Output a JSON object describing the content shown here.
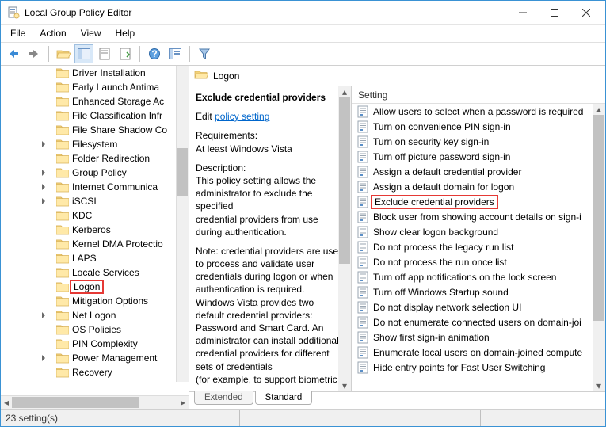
{
  "window": {
    "title": "Local Group Policy Editor"
  },
  "menu": {
    "file": "File",
    "action": "Action",
    "view": "View",
    "help": "Help"
  },
  "header": {
    "section_label": "Logon"
  },
  "desc": {
    "title": "Exclude credential providers",
    "edit_prefix": "Edit ",
    "edit_link": "policy setting",
    "req_label": "Requirements:",
    "req_text": "At least Windows Vista",
    "desc_label": "Description:",
    "p1": "This policy setting allows the administrator to exclude the specified",
    "p2": "credential providers from use during authentication.",
    "p3": "Note: credential providers are used to process and validate user credentials during logon or when authentication is required. Windows Vista provides two default credential providers: Password and Smart Card. An administrator can install additional credential providers for different sets of credentials",
    "p4": "(for example, to support biometric"
  },
  "list": {
    "column": "Setting"
  },
  "tree_items": [
    {
      "label": "Driver Installation",
      "exp": false
    },
    {
      "label": "Early Launch Antima",
      "exp": false
    },
    {
      "label": "Enhanced Storage Ac",
      "exp": false
    },
    {
      "label": "File Classification Infr",
      "exp": false
    },
    {
      "label": "File Share Shadow Co",
      "exp": false
    },
    {
      "label": "Filesystem",
      "exp": true
    },
    {
      "label": "Folder Redirection",
      "exp": false
    },
    {
      "label": "Group Policy",
      "exp": true
    },
    {
      "label": "Internet Communica",
      "exp": true
    },
    {
      "label": "iSCSI",
      "exp": true
    },
    {
      "label": "KDC",
      "exp": false
    },
    {
      "label": "Kerberos",
      "exp": false
    },
    {
      "label": "Kernel DMA Protectio",
      "exp": false
    },
    {
      "label": "LAPS",
      "exp": false
    },
    {
      "label": "Locale Services",
      "exp": false
    },
    {
      "label": "Logon",
      "exp": false,
      "hl": true
    },
    {
      "label": "Mitigation Options",
      "exp": false
    },
    {
      "label": "Net Logon",
      "exp": true
    },
    {
      "label": "OS Policies",
      "exp": false
    },
    {
      "label": "PIN Complexity",
      "exp": false
    },
    {
      "label": "Power Management",
      "exp": true
    },
    {
      "label": "Recovery",
      "exp": false
    }
  ],
  "settings": [
    {
      "label": "Allow users to select when a password is required"
    },
    {
      "label": "Turn on convenience PIN sign-in"
    },
    {
      "label": "Turn on security key sign-in"
    },
    {
      "label": "Turn off picture password sign-in"
    },
    {
      "label": "Assign a default credential provider"
    },
    {
      "label": "Assign a default domain for logon"
    },
    {
      "label": "Exclude credential providers",
      "hl": true
    },
    {
      "label": "Block user from showing account details on sign-i"
    },
    {
      "label": "Show clear logon background"
    },
    {
      "label": "Do not process the legacy run list"
    },
    {
      "label": "Do not process the run once list"
    },
    {
      "label": "Turn off app notifications on the lock screen"
    },
    {
      "label": "Turn off Windows Startup sound"
    },
    {
      "label": "Do not display network selection UI"
    },
    {
      "label": "Do not enumerate connected users on domain-joi"
    },
    {
      "label": "Show first sign-in animation"
    },
    {
      "label": "Enumerate local users on domain-joined compute"
    },
    {
      "label": "Hide entry points for Fast User Switching"
    }
  ],
  "tabs": {
    "extended": "Extended",
    "standard": "Standard"
  },
  "status": {
    "text": "23 setting(s)"
  }
}
